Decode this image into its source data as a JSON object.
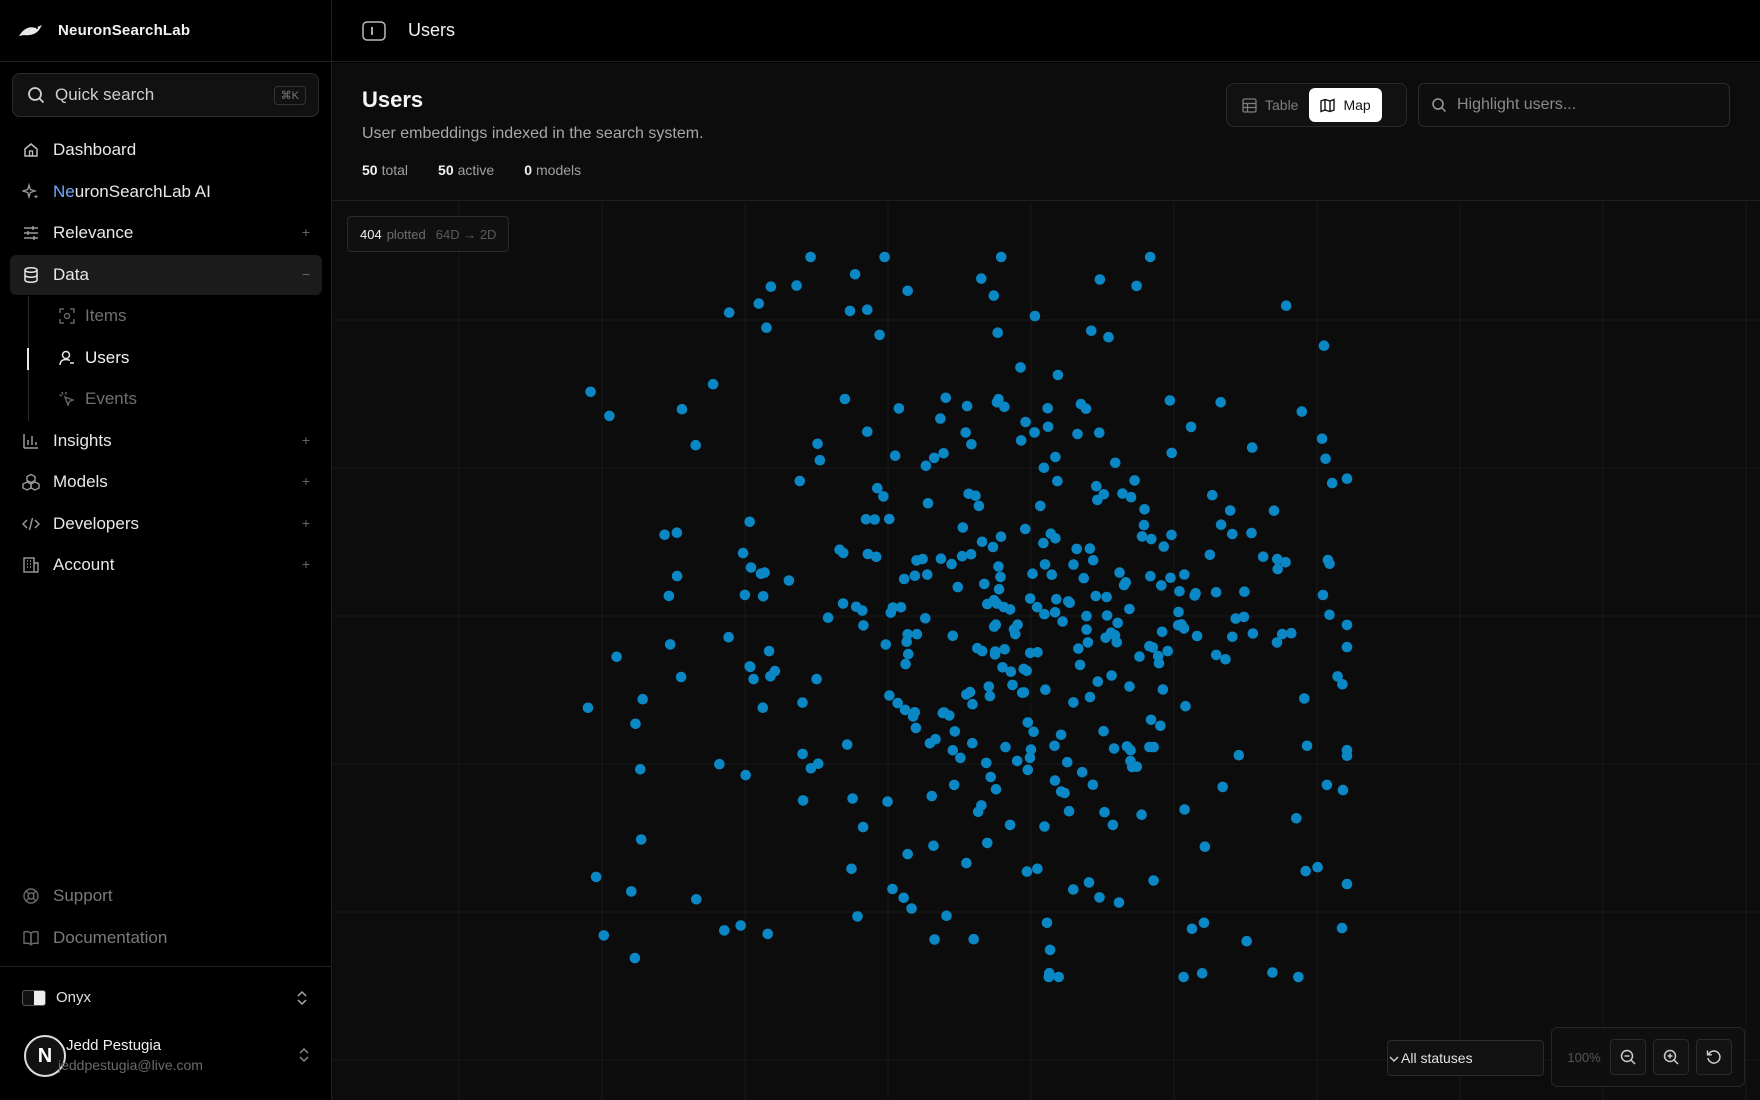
{
  "app": {
    "name": "NeuronSearchLab"
  },
  "search": {
    "label": "Quick search",
    "shortcut": "⌘K"
  },
  "nav": {
    "items": [
      {
        "label": "Dashboard",
        "icon": "home-icon"
      },
      {
        "label_pre": "Ne",
        "label_post": "uronSearchLab AI",
        "icon": "sparkle-icon"
      },
      {
        "label": "Relevance",
        "icon": "sliders-icon",
        "expand": "+"
      },
      {
        "label": "Data",
        "icon": "database-icon",
        "expand": "−"
      }
    ],
    "sub": [
      {
        "label": "Items",
        "icon": "scan-icon"
      },
      {
        "label": "Users",
        "icon": "user-icon"
      },
      {
        "label": "Events",
        "icon": "pointer-icon"
      }
    ],
    "more": [
      {
        "label": "Insights",
        "icon": "bar-chart-icon",
        "expand": "+"
      },
      {
        "label": "Models",
        "icon": "boxes-icon",
        "expand": "+"
      },
      {
        "label": "Developers",
        "icon": "code-icon",
        "expand": "+"
      },
      {
        "label": "Account",
        "icon": "building-icon",
        "expand": "+"
      }
    ],
    "bottom": [
      {
        "label": "Support",
        "icon": "lifebuoy-icon"
      },
      {
        "label": "Documentation",
        "icon": "book-icon"
      }
    ]
  },
  "workspace": {
    "name": "Onyx"
  },
  "user": {
    "name": "Jedd Pestugia",
    "email": "jeddpestugia@live.com",
    "avatar": "N"
  },
  "topbar": {
    "title": "Users"
  },
  "page": {
    "title": "Users",
    "subtitle": "User embeddings indexed in the search system.",
    "stats": [
      {
        "value": "50",
        "label": "total"
      },
      {
        "value": "50",
        "label": "active"
      },
      {
        "value": "0",
        "label": "models"
      }
    ]
  },
  "view_toggle": {
    "table": "Table",
    "map": "Map",
    "selected": "Map"
  },
  "highlight": {
    "placeholder": "Highlight users..."
  },
  "map": {
    "plotted": "404",
    "plotted_label": "plotted",
    "projection": "64D → 2D",
    "status_filter": "All statuses",
    "zoom": "100%",
    "point_color": "#0a87c4",
    "seed": 404
  }
}
